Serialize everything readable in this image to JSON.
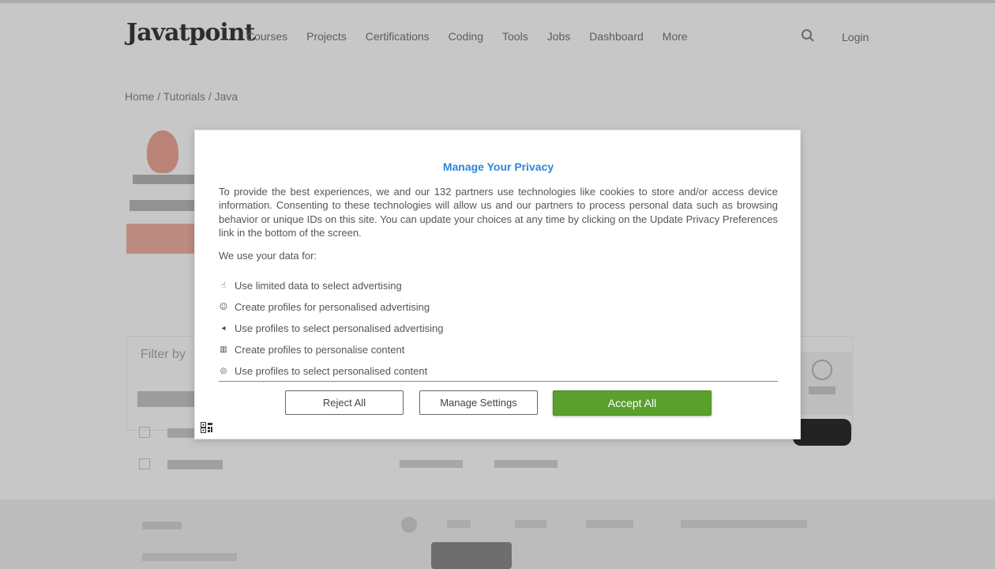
{
  "background": {
    "logo": "Javatpoint",
    "nav": [
      "Courses",
      "Projects",
      "Certifications",
      "Coding",
      "Tools",
      "Jobs",
      "Dashboard",
      "More"
    ],
    "login_label": "Login",
    "breadcrumb": "Home / Tutorials / Java",
    "filter_label": "Filter by"
  },
  "modal": {
    "title": "Manage Your Privacy",
    "description": "To provide the best experiences, we and our 132 partners use technologies like cookies to store and/or access device information. Consenting to these technologies will allow us and our partners to process personal data such as browsing behavior or unique IDs on this site. You can update your choices at any time by clicking on the Update Privacy Preferences link in the bottom of the screen.",
    "lead": "We use your data for:",
    "purposes": [
      {
        "label": "Use limited data to select advertising",
        "icon": "hand-pointer-icon"
      },
      {
        "label": "Create profiles for personalised advertising",
        "icon": "face-icon"
      },
      {
        "label": "Use profiles to select personalised advertising",
        "icon": "megaphone-icon"
      },
      {
        "label": "Create profiles to personalise content",
        "icon": "chart-icon"
      },
      {
        "label": "Use profiles to select personalised content",
        "icon": "target-icon"
      }
    ],
    "buttons": {
      "reject": "Reject All",
      "manage": "Manage Settings",
      "accept": "Accept All"
    }
  },
  "colors": {
    "title": "#2f86d9",
    "accept": "#5aa02c"
  }
}
